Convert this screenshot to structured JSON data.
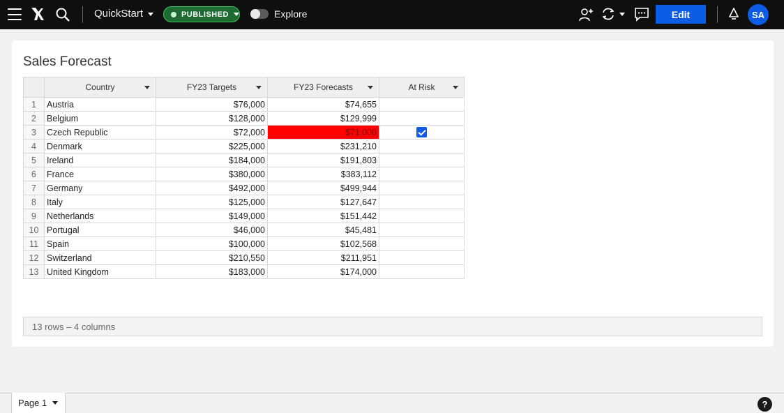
{
  "topbar": {
    "workbook_title": "QuickStart",
    "status": "PUBLISHED",
    "explore_label": "Explore",
    "edit_label": "Edit",
    "avatar_initials": "SA",
    "icons": [
      "menu-icon",
      "logo-icon",
      "search-icon",
      "user-add-icon",
      "sync-icon",
      "comment-icon",
      "bell-icon"
    ],
    "colors": {
      "bar": "#0f0f0f",
      "primary": "#0d5ce6",
      "published": "#1d6b33"
    }
  },
  "page": {
    "title": "Sales Forecast"
  },
  "table": {
    "columns": [
      "Country",
      "FY23 Targets",
      "FY23 Forecasts",
      "At Risk"
    ],
    "rows": [
      {
        "n": "1",
        "country": "Austria",
        "target": "$76,000",
        "forecast": "$74,655",
        "at_risk": false
      },
      {
        "n": "2",
        "country": "Belgium",
        "target": "$128,000",
        "forecast": "$129,999",
        "at_risk": false
      },
      {
        "n": "3",
        "country": "Czech Republic",
        "target": "$72,000",
        "forecast": "$71,000",
        "at_risk": true
      },
      {
        "n": "4",
        "country": "Denmark",
        "target": "$225,000",
        "forecast": "$231,210",
        "at_risk": false
      },
      {
        "n": "5",
        "country": "Ireland",
        "target": "$184,000",
        "forecast": "$191,803",
        "at_risk": false
      },
      {
        "n": "6",
        "country": "France",
        "target": "$380,000",
        "forecast": "$383,112",
        "at_risk": false
      },
      {
        "n": "7",
        "country": "Germany",
        "target": "$492,000",
        "forecast": "$499,944",
        "at_risk": false
      },
      {
        "n": "8",
        "country": "Italy",
        "target": "$125,000",
        "forecast": "$127,647",
        "at_risk": false
      },
      {
        "n": "9",
        "country": "Netherlands",
        "target": "$149,000",
        "forecast": "$151,442",
        "at_risk": false
      },
      {
        "n": "10",
        "country": "Portugal",
        "target": "$46,000",
        "forecast": "$45,481",
        "at_risk": false
      },
      {
        "n": "11",
        "country": "Spain",
        "target": "$100,000",
        "forecast": "$102,568",
        "at_risk": false
      },
      {
        "n": "12",
        "country": "Switzerland",
        "target": "$210,550",
        "forecast": "$211,951",
        "at_risk": false
      },
      {
        "n": "13",
        "country": "United Kingdom",
        "target": "$183,000",
        "forecast": "$174,000",
        "at_risk": false
      }
    ],
    "alert_color": "#ff0000",
    "summary": "13 rows – 4 columns"
  },
  "bottombar": {
    "page_tab": "Page 1",
    "help": "?"
  }
}
